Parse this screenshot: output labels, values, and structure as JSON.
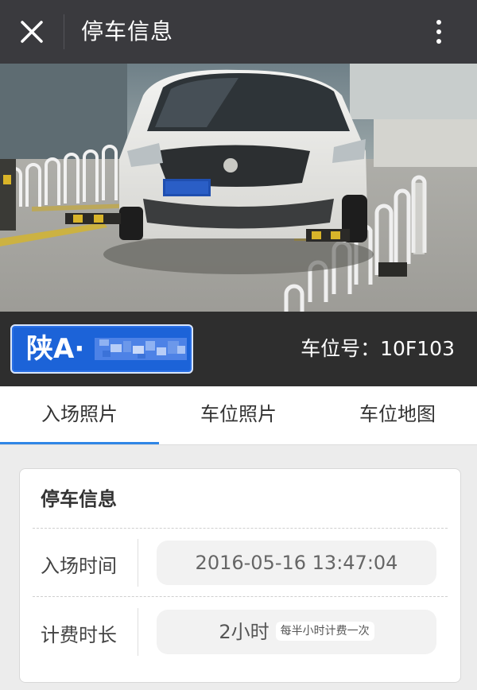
{
  "header": {
    "title": "停车信息",
    "close_icon": "close-icon",
    "more_icon": "more-vertical-icon"
  },
  "photo": {
    "description_icon": "entry-photo-car"
  },
  "info_bar": {
    "plate_prefix": "陕A·",
    "plate_blurred": true,
    "slot_label": "车位号：",
    "slot_value": "10F103",
    "slot_text": "车位号：10F103"
  },
  "tabs": [
    {
      "label": "入场照片",
      "active": true
    },
    {
      "label": "车位照片",
      "active": false
    },
    {
      "label": "车位地图",
      "active": false
    }
  ],
  "card": {
    "title": "停车信息",
    "rows": [
      {
        "label": "入场时间",
        "value": "2016-05-16 13:47:04"
      },
      {
        "label": "计费时长",
        "value": "2小时",
        "hint": "每半小时计费一次"
      }
    ]
  },
  "colors": {
    "header_bg": "#3a3a3e",
    "info_bar_bg": "#2e2e2e",
    "plate_blue": "#1c63d8",
    "tab_active": "#2f86e6",
    "page_bg": "#ececec"
  }
}
